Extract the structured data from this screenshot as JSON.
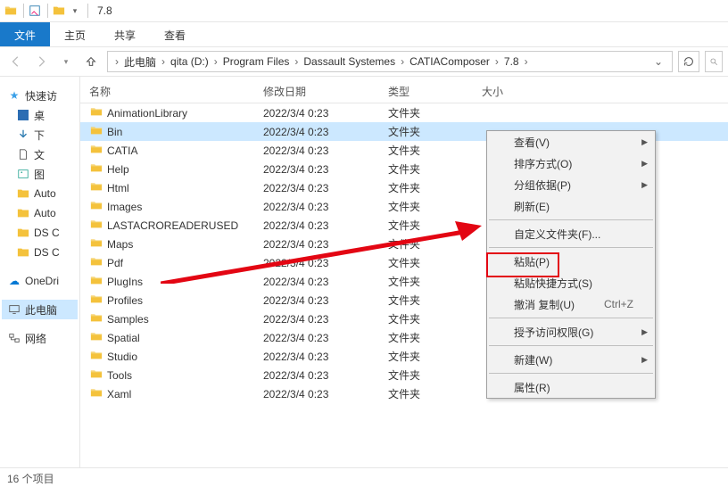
{
  "titlebar": {
    "title": "7.8"
  },
  "ribbon": {
    "tabs": [
      {
        "label": "文件",
        "active": true
      },
      {
        "label": "主页",
        "active": false
      },
      {
        "label": "共享",
        "active": false
      },
      {
        "label": "查看",
        "active": false
      }
    ]
  },
  "breadcrumb": {
    "segments": [
      "此电脑",
      "qita (D:)",
      "Program Files",
      "Dassault Systemes",
      "CATIAComposer",
      "7.8"
    ]
  },
  "sidebar": {
    "quick": "快速访",
    "items": [
      "桌",
      "下",
      "文",
      "图",
      "Auto",
      "Auto",
      "DS C",
      "DS C"
    ],
    "onedrive": "OneDri",
    "thispc": "此电脑",
    "network": "网络"
  },
  "columns": {
    "name": "名称",
    "date": "修改日期",
    "type": "类型",
    "size": "大小"
  },
  "type_folder": "文件夹",
  "rows": [
    {
      "name": "AnimationLibrary",
      "date": "2022/3/4 0:23",
      "sel": false
    },
    {
      "name": "Bin",
      "date": "2022/3/4 0:23",
      "sel": true
    },
    {
      "name": "CATIA",
      "date": "2022/3/4 0:23",
      "sel": false
    },
    {
      "name": "Help",
      "date": "2022/3/4 0:23",
      "sel": false
    },
    {
      "name": "Html",
      "date": "2022/3/4 0:23",
      "sel": false
    },
    {
      "name": "Images",
      "date": "2022/3/4 0:23",
      "sel": false
    },
    {
      "name": "LASTACROREADERUSED",
      "date": "2022/3/4 0:23",
      "sel": false
    },
    {
      "name": "Maps",
      "date": "2022/3/4 0:23",
      "sel": false
    },
    {
      "name": "Pdf",
      "date": "2022/3/4 0:23",
      "sel": false
    },
    {
      "name": "PlugIns",
      "date": "2022/3/4 0:23",
      "sel": false
    },
    {
      "name": "Profiles",
      "date": "2022/3/4 0:23",
      "sel": false
    },
    {
      "name": "Samples",
      "date": "2022/3/4 0:23",
      "sel": false
    },
    {
      "name": "Spatial",
      "date": "2022/3/4 0:23",
      "sel": false
    },
    {
      "name": "Studio",
      "date": "2022/3/4 0:23",
      "sel": false
    },
    {
      "name": "Tools",
      "date": "2022/3/4 0:23",
      "sel": false
    },
    {
      "name": "Xaml",
      "date": "2022/3/4 0:23",
      "sel": false
    }
  ],
  "contextmenu": {
    "items": [
      {
        "label": "查看(V)",
        "sub": true
      },
      {
        "label": "排序方式(O)",
        "sub": true
      },
      {
        "label": "分组依据(P)",
        "sub": true
      },
      {
        "label": "刷新(E)"
      },
      {
        "sep": true
      },
      {
        "label": "自定义文件夹(F)..."
      },
      {
        "sep": true
      },
      {
        "label": "粘贴(P)",
        "highlight": true
      },
      {
        "label": "粘贴快捷方式(S)"
      },
      {
        "label": "撤消 复制(U)",
        "shortcut": "Ctrl+Z"
      },
      {
        "sep": true
      },
      {
        "label": "授予访问权限(G)",
        "sub": true
      },
      {
        "sep": true
      },
      {
        "label": "新建(W)",
        "sub": true
      },
      {
        "sep": true
      },
      {
        "label": "属性(R)"
      }
    ]
  },
  "status": "16 个项目"
}
